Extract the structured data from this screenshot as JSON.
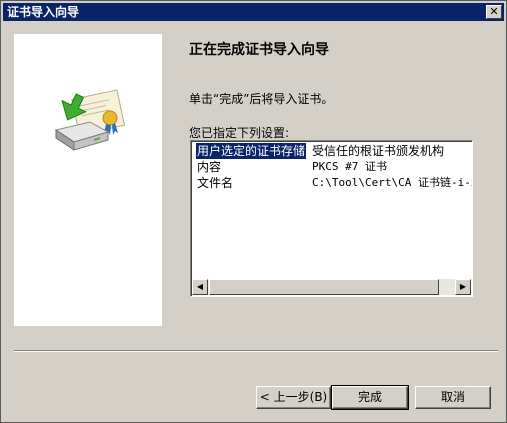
{
  "window": {
    "title": "证书导入向导",
    "close_label": "✕"
  },
  "wizard": {
    "heading": "正在完成证书导入向导",
    "message": "单击“完成”后将导入证书。",
    "settings_label": "您已指定下列设置:",
    "icon": "certificate-import-icon"
  },
  "settings": [
    {
      "key": "用户选定的证书存储",
      "value": "受信任的根证书颁发机构",
      "selected": true
    },
    {
      "key": "内容",
      "value": "PKCS #7 证书",
      "selected": false
    },
    {
      "key": "文件名",
      "value": "C:\\Tool\\Cert\\CA 证书链-i-x-",
      "selected": false
    }
  ],
  "buttons": {
    "back": "< 上一步(B)",
    "finish": "完成",
    "cancel": "取消"
  },
  "colors": {
    "titlebar": "#0a246a",
    "selection": "#0a246a",
    "dialog": "#d4d0c8"
  }
}
